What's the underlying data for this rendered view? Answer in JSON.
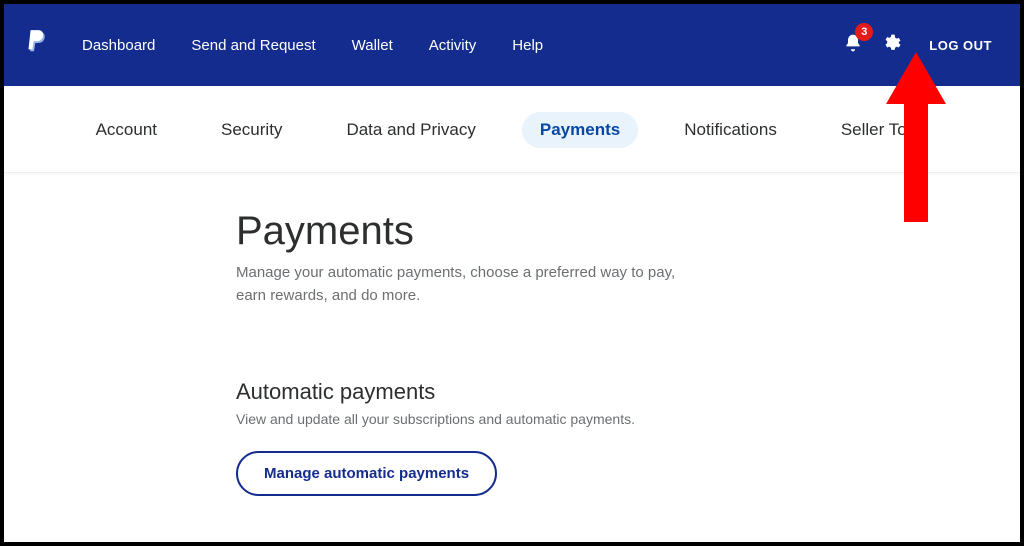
{
  "header": {
    "nav": [
      {
        "label": "Dashboard"
      },
      {
        "label": "Send and Request"
      },
      {
        "label": "Wallet"
      },
      {
        "label": "Activity"
      },
      {
        "label": "Help"
      }
    ],
    "notif_count": "3",
    "logout_label": "LOG OUT"
  },
  "subnav": {
    "items": [
      {
        "label": "Account",
        "active": false
      },
      {
        "label": "Security",
        "active": false
      },
      {
        "label": "Data and Privacy",
        "active": false
      },
      {
        "label": "Payments",
        "active": true
      },
      {
        "label": "Notifications",
        "active": false
      },
      {
        "label": "Seller Tools",
        "active": false
      }
    ]
  },
  "main": {
    "title": "Payments",
    "subtitle": "Manage your automatic payments, choose a preferred way to pay, earn rewards, and do more.",
    "section": {
      "title": "Automatic payments",
      "desc": "View and update all your subscriptions and automatic payments.",
      "button_label": "Manage automatic payments"
    }
  }
}
